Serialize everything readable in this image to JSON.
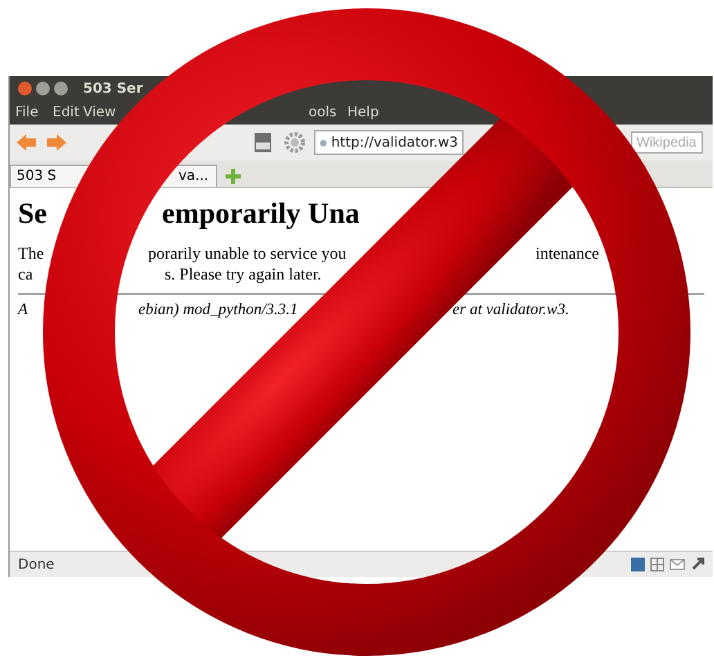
{
  "window": {
    "title": "503 Ser"
  },
  "menu": [
    "File",
    "Edit",
    "View",
    "ools",
    "Help"
  ],
  "toolbar": {
    "url": "http://validator.w3",
    "search_placeholder": "Wikipedia"
  },
  "tabs": [
    {
      "label_parts": [
        "503 S",
        "va..."
      ],
      "selected": true
    }
  ],
  "page": {
    "heading": [
      "Se",
      "emporarily Una"
    ],
    "paragraph_lines": [
      [
        "The",
        "porarily unable to service you",
        "intenance"
      ],
      [
        "ca",
        "s. Please try again later."
      ]
    ],
    "address": [
      "A",
      "ebian) mod_python/3.3.1",
      "er at validator.w3."
    ]
  },
  "status_bar": {
    "text": "Done"
  }
}
